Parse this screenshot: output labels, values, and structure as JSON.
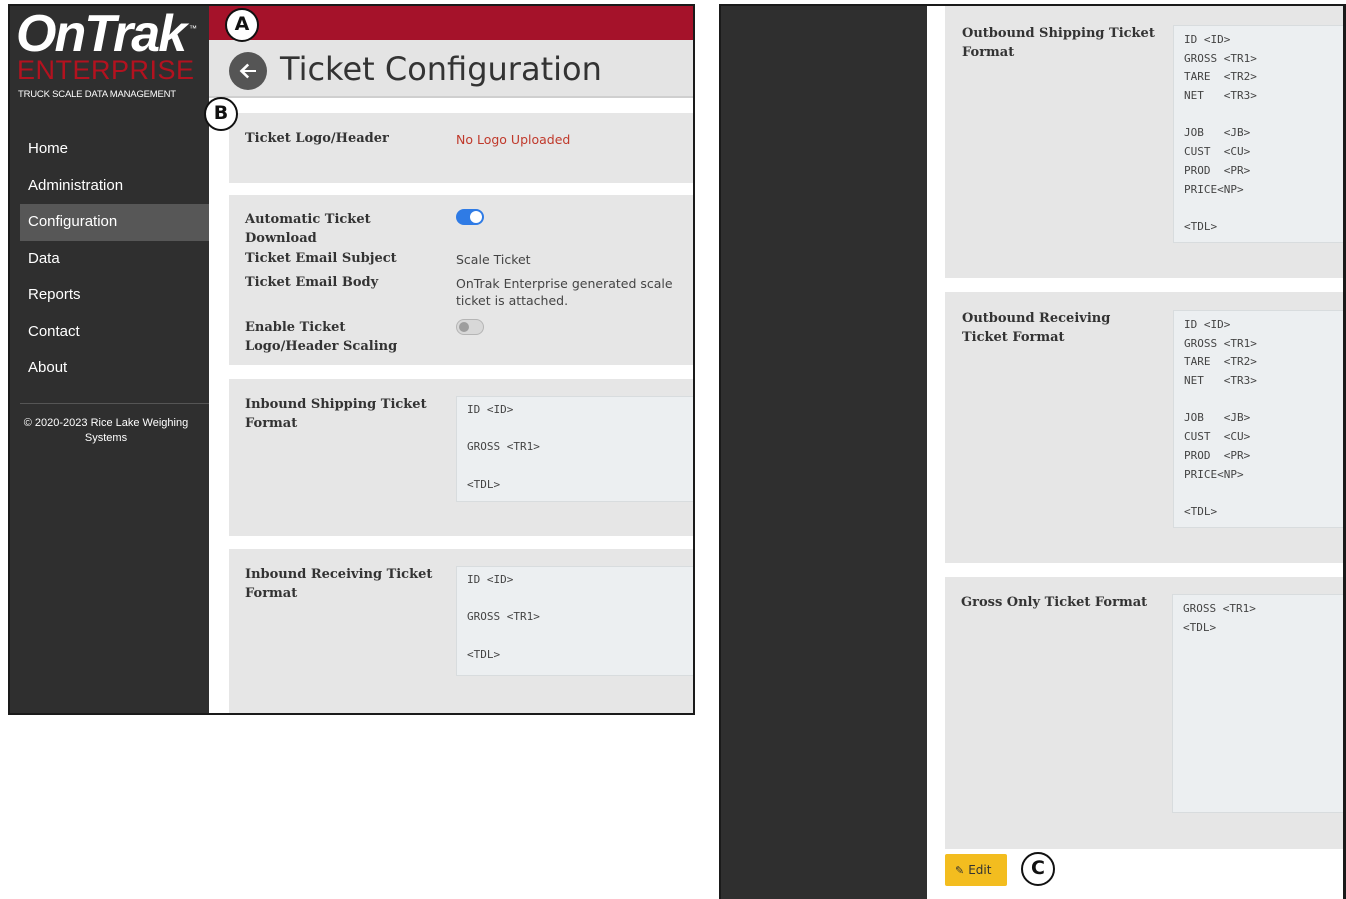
{
  "logo": {
    "main": "OnTrak",
    "tm": "™",
    "sub": "ENTERPRISE",
    "tagline": "TRUCK SCALE DATA MANAGEMENT"
  },
  "nav": [
    "Home",
    "Administration",
    "Configuration",
    "Data",
    "Reports",
    "Contact",
    "About"
  ],
  "nav_active": "Configuration",
  "copyright": "© 2020-2023 Rice Lake Weighing Systems",
  "page_title": "Ticket Configuration",
  "logo_header": {
    "label": "Ticket Logo/Header",
    "value": "No Logo Uploaded"
  },
  "settings": {
    "auto_download_label": "Automatic Ticket Download",
    "auto_download_on": true,
    "subject_label": "Ticket Email Subject",
    "subject_value": "Scale Ticket",
    "body_label": "Ticket Email Body",
    "body_value": "OnTrak Enterprise generated scale ticket is attached.",
    "scaling_label": "Enable Ticket Logo/Header Scaling",
    "scaling_on": false
  },
  "formats": {
    "inbound_shipping": {
      "label": "Inbound Shipping Ticket Format",
      "lines": [
        "ID <ID>",
        "",
        "GROSS <TR1>",
        "",
        "<TDL>"
      ]
    },
    "inbound_receiving": {
      "label": "Inbound Receiving Ticket Format",
      "lines": [
        "ID <ID>",
        "",
        "GROSS <TR1>",
        "",
        "<TDL>"
      ]
    },
    "outbound_shipping": {
      "label": "Outbound Shipping Ticket Format",
      "lines": [
        "ID <ID>",
        "GROSS <TR1>",
        "TARE  <TR2>",
        "NET   <TR3>",
        "",
        "JOB   <JB>",
        "CUST  <CU>",
        "PROD  <PR>",
        "PRICE<NP>",
        "",
        "<TDL>"
      ]
    },
    "outbound_receiving": {
      "label": "Outbound Receiving Ticket Format",
      "lines": [
        "ID <ID>",
        "GROSS <TR1>",
        "TARE  <TR2>",
        "NET   <TR3>",
        "",
        "JOB   <JB>",
        "CUST  <CU>",
        "PROD  <PR>",
        "PRICE<NP>",
        "",
        "<TDL>"
      ]
    },
    "gross_only": {
      "label": "Gross Only Ticket Format",
      "lines": [
        "GROSS <TR1>",
        "<TDL>"
      ]
    }
  },
  "edit_button": "Edit",
  "callouts": {
    "a": "A",
    "b": "B",
    "c": "C"
  },
  "colors": {
    "brand_red": "#a5122a",
    "sidebar": "#2f2f2f",
    "toggle_on": "#2f7be5",
    "edit": "#f3bd1f",
    "error_text": "#c0392b"
  }
}
